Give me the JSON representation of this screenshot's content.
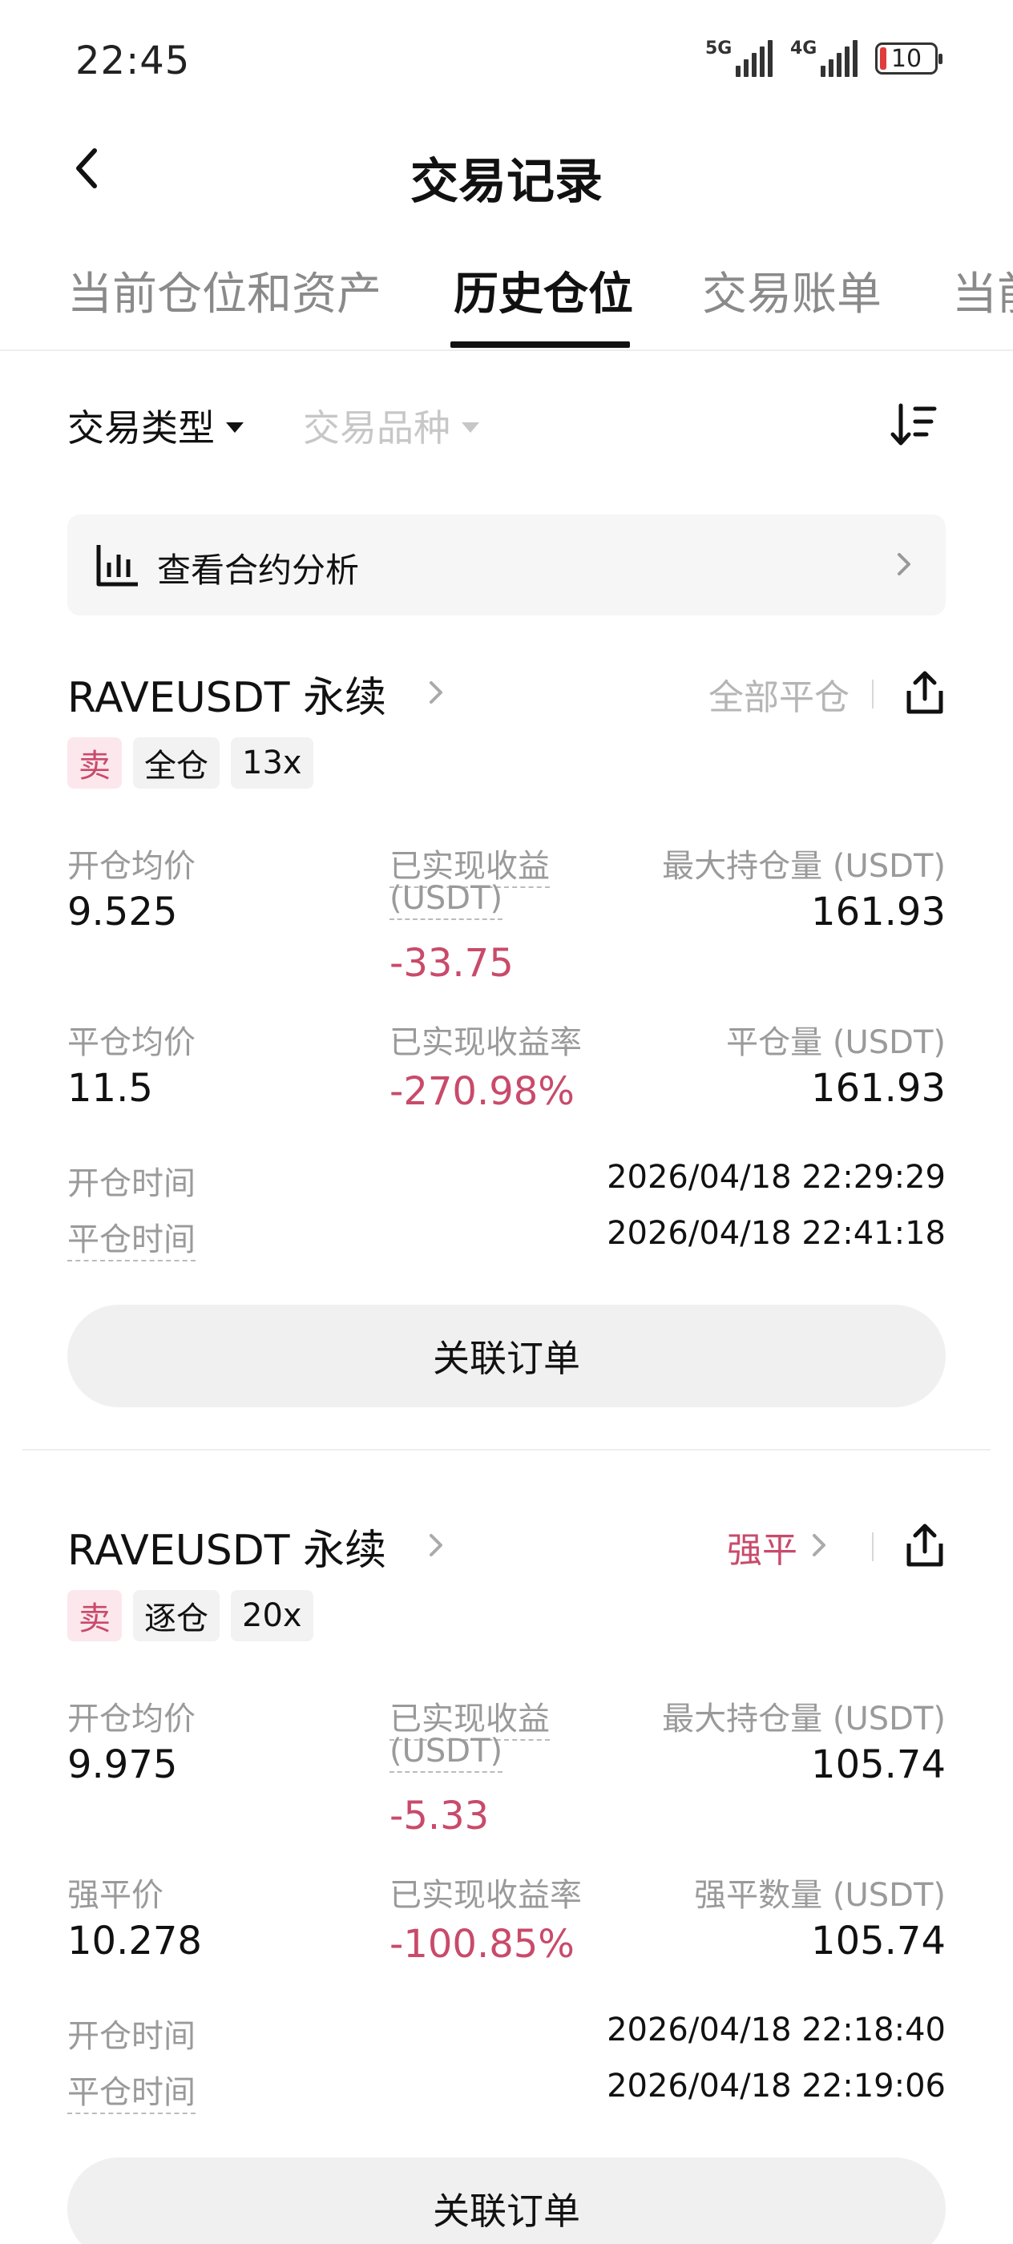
{
  "status_bar": {
    "time": "22:45",
    "network_1": "5G",
    "network_2": "4G",
    "battery": "10"
  },
  "header": {
    "title": "交易记录",
    "back_icon": "chevron-left-icon"
  },
  "tabs": [
    {
      "label": "当前仓位和资产",
      "active": false
    },
    {
      "label": "历史仓位",
      "active": true
    },
    {
      "label": "交易账单",
      "active": false
    },
    {
      "label": "当前",
      "active": false
    }
  ],
  "filters": {
    "type_label": "交易类型",
    "product_label": "交易品种",
    "sort_icon": "sort-icon"
  },
  "analysis": {
    "label": "查看合约分析",
    "icon": "bar-chart-icon"
  },
  "positions": [
    {
      "symbol": "RAVEUSDT 永续",
      "status": "全部平仓",
      "tags": [
        "卖",
        "全仓",
        "13x"
      ],
      "open_avg_label": "开仓均价",
      "open_avg": "9.525",
      "pnl_label": "已实现收益",
      "pnl_unit": "(USDT)",
      "pnl": "-33.75",
      "max_pos_label": "最大持仓量 (USDT)",
      "max_pos": "161.93",
      "close_avg_label": "平仓均价",
      "close_avg": "11.5",
      "pnl_rate_label": "已实现收益率",
      "pnl_rate": "-270.98%",
      "close_qty_label": "平仓量 (USDT)",
      "close_qty": "161.93",
      "open_time_label": "开仓时间",
      "open_time": "2026/04/18 22:29:29",
      "close_time_label": "平仓时间",
      "close_time": "2026/04/18 22:41:18",
      "linked_button": "关联订单"
    },
    {
      "symbol": "RAVEUSDT 永续",
      "status": "强平",
      "tags": [
        "卖",
        "逐仓",
        "20x"
      ],
      "open_avg_label": "开仓均价",
      "open_avg": "9.975",
      "pnl_label": "已实现收益",
      "pnl_unit": "(USDT)",
      "pnl": "-5.33",
      "max_pos_label": "最大持仓量 (USDT)",
      "max_pos": "105.74",
      "close_avg_label": "强平价",
      "close_avg": "10.278",
      "pnl_rate_label": "已实现收益率",
      "pnl_rate": "-100.85%",
      "close_qty_label": "强平数量 (USDT)",
      "close_qty": "105.74",
      "open_time_label": "开仓时间",
      "open_time": "2026/04/18 22:18:40",
      "close_time_label": "平仓时间",
      "close_time": "2026/04/18 22:19:06",
      "linked_button": "关联订单"
    }
  ],
  "colors": {
    "loss_red": "#c94a6a",
    "sell_tag_bg": "#fbe7ec",
    "muted_text": "#9a9a9a"
  }
}
